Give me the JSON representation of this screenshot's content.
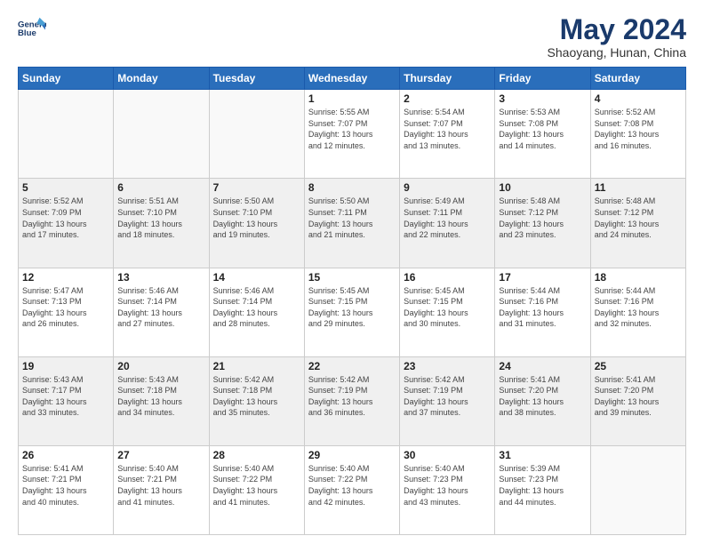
{
  "logo": {
    "line1": "General",
    "line2": "Blue"
  },
  "title": "May 2024",
  "subtitle": "Shaoyang, Hunan, China",
  "days_of_week": [
    "Sunday",
    "Monday",
    "Tuesday",
    "Wednesday",
    "Thursday",
    "Friday",
    "Saturday"
  ],
  "weeks": [
    {
      "shaded": false,
      "days": [
        {
          "num": "",
          "info": ""
        },
        {
          "num": "",
          "info": ""
        },
        {
          "num": "",
          "info": ""
        },
        {
          "num": "1",
          "info": "Sunrise: 5:55 AM\nSunset: 7:07 PM\nDaylight: 13 hours\nand 12 minutes."
        },
        {
          "num": "2",
          "info": "Sunrise: 5:54 AM\nSunset: 7:07 PM\nDaylight: 13 hours\nand 13 minutes."
        },
        {
          "num": "3",
          "info": "Sunrise: 5:53 AM\nSunset: 7:08 PM\nDaylight: 13 hours\nand 14 minutes."
        },
        {
          "num": "4",
          "info": "Sunrise: 5:52 AM\nSunset: 7:08 PM\nDaylight: 13 hours\nand 16 minutes."
        }
      ]
    },
    {
      "shaded": true,
      "days": [
        {
          "num": "5",
          "info": "Sunrise: 5:52 AM\nSunset: 7:09 PM\nDaylight: 13 hours\nand 17 minutes."
        },
        {
          "num": "6",
          "info": "Sunrise: 5:51 AM\nSunset: 7:10 PM\nDaylight: 13 hours\nand 18 minutes."
        },
        {
          "num": "7",
          "info": "Sunrise: 5:50 AM\nSunset: 7:10 PM\nDaylight: 13 hours\nand 19 minutes."
        },
        {
          "num": "8",
          "info": "Sunrise: 5:50 AM\nSunset: 7:11 PM\nDaylight: 13 hours\nand 21 minutes."
        },
        {
          "num": "9",
          "info": "Sunrise: 5:49 AM\nSunset: 7:11 PM\nDaylight: 13 hours\nand 22 minutes."
        },
        {
          "num": "10",
          "info": "Sunrise: 5:48 AM\nSunset: 7:12 PM\nDaylight: 13 hours\nand 23 minutes."
        },
        {
          "num": "11",
          "info": "Sunrise: 5:48 AM\nSunset: 7:12 PM\nDaylight: 13 hours\nand 24 minutes."
        }
      ]
    },
    {
      "shaded": false,
      "days": [
        {
          "num": "12",
          "info": "Sunrise: 5:47 AM\nSunset: 7:13 PM\nDaylight: 13 hours\nand 26 minutes."
        },
        {
          "num": "13",
          "info": "Sunrise: 5:46 AM\nSunset: 7:14 PM\nDaylight: 13 hours\nand 27 minutes."
        },
        {
          "num": "14",
          "info": "Sunrise: 5:46 AM\nSunset: 7:14 PM\nDaylight: 13 hours\nand 28 minutes."
        },
        {
          "num": "15",
          "info": "Sunrise: 5:45 AM\nSunset: 7:15 PM\nDaylight: 13 hours\nand 29 minutes."
        },
        {
          "num": "16",
          "info": "Sunrise: 5:45 AM\nSunset: 7:15 PM\nDaylight: 13 hours\nand 30 minutes."
        },
        {
          "num": "17",
          "info": "Sunrise: 5:44 AM\nSunset: 7:16 PM\nDaylight: 13 hours\nand 31 minutes."
        },
        {
          "num": "18",
          "info": "Sunrise: 5:44 AM\nSunset: 7:16 PM\nDaylight: 13 hours\nand 32 minutes."
        }
      ]
    },
    {
      "shaded": true,
      "days": [
        {
          "num": "19",
          "info": "Sunrise: 5:43 AM\nSunset: 7:17 PM\nDaylight: 13 hours\nand 33 minutes."
        },
        {
          "num": "20",
          "info": "Sunrise: 5:43 AM\nSunset: 7:18 PM\nDaylight: 13 hours\nand 34 minutes."
        },
        {
          "num": "21",
          "info": "Sunrise: 5:42 AM\nSunset: 7:18 PM\nDaylight: 13 hours\nand 35 minutes."
        },
        {
          "num": "22",
          "info": "Sunrise: 5:42 AM\nSunset: 7:19 PM\nDaylight: 13 hours\nand 36 minutes."
        },
        {
          "num": "23",
          "info": "Sunrise: 5:42 AM\nSunset: 7:19 PM\nDaylight: 13 hours\nand 37 minutes."
        },
        {
          "num": "24",
          "info": "Sunrise: 5:41 AM\nSunset: 7:20 PM\nDaylight: 13 hours\nand 38 minutes."
        },
        {
          "num": "25",
          "info": "Sunrise: 5:41 AM\nSunset: 7:20 PM\nDaylight: 13 hours\nand 39 minutes."
        }
      ]
    },
    {
      "shaded": false,
      "days": [
        {
          "num": "26",
          "info": "Sunrise: 5:41 AM\nSunset: 7:21 PM\nDaylight: 13 hours\nand 40 minutes."
        },
        {
          "num": "27",
          "info": "Sunrise: 5:40 AM\nSunset: 7:21 PM\nDaylight: 13 hours\nand 41 minutes."
        },
        {
          "num": "28",
          "info": "Sunrise: 5:40 AM\nSunset: 7:22 PM\nDaylight: 13 hours\nand 41 minutes."
        },
        {
          "num": "29",
          "info": "Sunrise: 5:40 AM\nSunset: 7:22 PM\nDaylight: 13 hours\nand 42 minutes."
        },
        {
          "num": "30",
          "info": "Sunrise: 5:40 AM\nSunset: 7:23 PM\nDaylight: 13 hours\nand 43 minutes."
        },
        {
          "num": "31",
          "info": "Sunrise: 5:39 AM\nSunset: 7:23 PM\nDaylight: 13 hours\nand 44 minutes."
        },
        {
          "num": "",
          "info": ""
        }
      ]
    }
  ]
}
